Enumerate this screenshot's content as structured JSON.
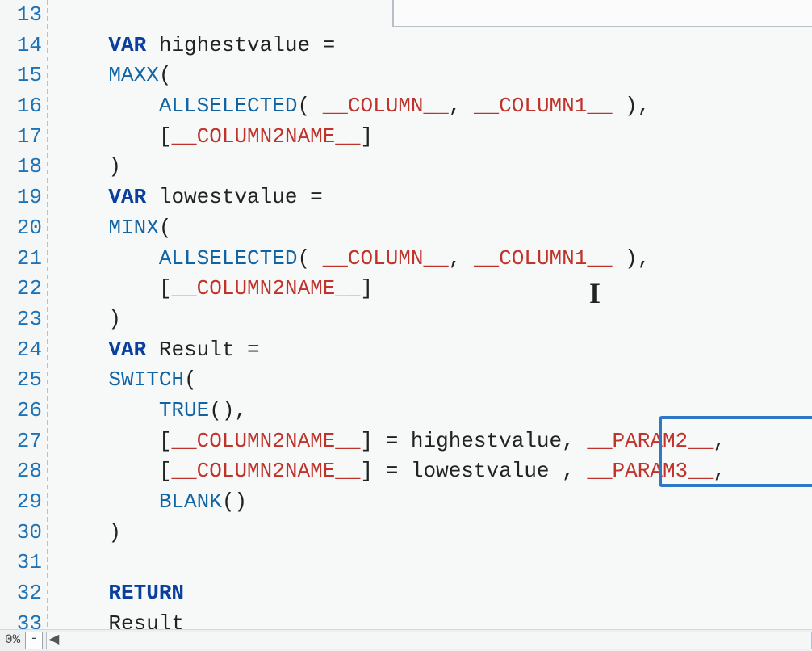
{
  "lines": [
    {
      "n": "13",
      "segs": []
    },
    {
      "n": "14",
      "segs": [
        {
          "t": "    ",
          "c": ""
        },
        {
          "t": "VAR",
          "c": "kw-var"
        },
        {
          "t": " highestvalue =",
          "c": ""
        }
      ]
    },
    {
      "n": "15",
      "segs": [
        {
          "t": "    ",
          "c": ""
        },
        {
          "t": "MAXX",
          "c": "fn"
        },
        {
          "t": "(",
          "c": ""
        }
      ]
    },
    {
      "n": "16",
      "segs": [
        {
          "t": "        ",
          "c": ""
        },
        {
          "t": "ALLSELECTED",
          "c": "fn"
        },
        {
          "t": "( ",
          "c": ""
        },
        {
          "t": "__COLUMN__",
          "c": "ph"
        },
        {
          "t": ", ",
          "c": ""
        },
        {
          "t": "__COLUMN1__",
          "c": "ph"
        },
        {
          "t": " ),",
          "c": ""
        }
      ]
    },
    {
      "n": "17",
      "segs": [
        {
          "t": "        [",
          "c": ""
        },
        {
          "t": "__COLUMN2NAME__",
          "c": "ph"
        },
        {
          "t": "]",
          "c": ""
        }
      ]
    },
    {
      "n": "18",
      "segs": [
        {
          "t": "    )",
          "c": ""
        }
      ]
    },
    {
      "n": "19",
      "segs": [
        {
          "t": "    ",
          "c": ""
        },
        {
          "t": "VAR",
          "c": "kw-var"
        },
        {
          "t": " lowestvalue =",
          "c": ""
        }
      ]
    },
    {
      "n": "20",
      "segs": [
        {
          "t": "    ",
          "c": ""
        },
        {
          "t": "MINX",
          "c": "fn"
        },
        {
          "t": "(",
          "c": ""
        }
      ]
    },
    {
      "n": "21",
      "segs": [
        {
          "t": "        ",
          "c": ""
        },
        {
          "t": "ALLSELECTED",
          "c": "fn"
        },
        {
          "t": "( ",
          "c": ""
        },
        {
          "t": "__COLUMN__",
          "c": "ph"
        },
        {
          "t": ", ",
          "c": ""
        },
        {
          "t": "__COLUMN1__",
          "c": "ph"
        },
        {
          "t": " ),",
          "c": ""
        }
      ]
    },
    {
      "n": "22",
      "segs": [
        {
          "t": "        [",
          "c": ""
        },
        {
          "t": "__COLUMN2NAME__",
          "c": "ph"
        },
        {
          "t": "]",
          "c": ""
        }
      ]
    },
    {
      "n": "23",
      "segs": [
        {
          "t": "    )",
          "c": ""
        }
      ]
    },
    {
      "n": "24",
      "segs": [
        {
          "t": "    ",
          "c": ""
        },
        {
          "t": "VAR",
          "c": "kw-var"
        },
        {
          "t": " Result =",
          "c": ""
        }
      ]
    },
    {
      "n": "25",
      "segs": [
        {
          "t": "    ",
          "c": ""
        },
        {
          "t": "SWITCH",
          "c": "fn"
        },
        {
          "t": "(",
          "c": ""
        }
      ]
    },
    {
      "n": "26",
      "segs": [
        {
          "t": "        ",
          "c": ""
        },
        {
          "t": "TRUE",
          "c": "fn"
        },
        {
          "t": "(),",
          "c": ""
        }
      ]
    },
    {
      "n": "27",
      "segs": [
        {
          "t": "        [",
          "c": ""
        },
        {
          "t": "__COLUMN2NAME__",
          "c": "ph"
        },
        {
          "t": "] = highestvalue, ",
          "c": ""
        },
        {
          "t": "__PARAM2__",
          "c": "ph"
        },
        {
          "t": ",",
          "c": ""
        }
      ]
    },
    {
      "n": "28",
      "segs": [
        {
          "t": "        [",
          "c": ""
        },
        {
          "t": "__COLUMN2NAME__",
          "c": "ph"
        },
        {
          "t": "] = lowestvalue , ",
          "c": ""
        },
        {
          "t": "__PARAM3__",
          "c": "ph"
        },
        {
          "t": ",",
          "c": ""
        }
      ]
    },
    {
      "n": "29",
      "segs": [
        {
          "t": "        ",
          "c": ""
        },
        {
          "t": "BLANK",
          "c": "fn"
        },
        {
          "t": "()",
          "c": ""
        }
      ]
    },
    {
      "n": "30",
      "segs": [
        {
          "t": "    )",
          "c": ""
        }
      ]
    },
    {
      "n": "31",
      "segs": []
    },
    {
      "n": "32",
      "segs": [
        {
          "t": "    ",
          "c": ""
        },
        {
          "t": "RETURN",
          "c": "kw-return"
        }
      ]
    },
    {
      "n": "33",
      "segs": [
        {
          "t": "    Result",
          "c": ""
        }
      ]
    }
  ],
  "statusbar": {
    "zoom_partial": "0%",
    "stepper": "-",
    "scroll_left": "◀"
  },
  "caret": "I"
}
